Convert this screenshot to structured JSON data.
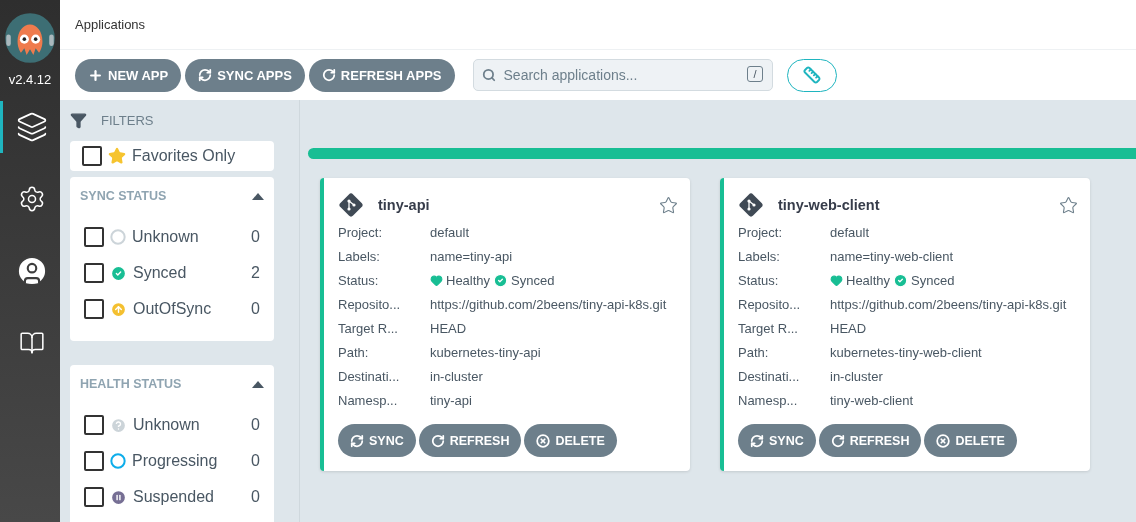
{
  "nav": {
    "version": "v2.4.12",
    "items": [
      {
        "kind": "applications",
        "selected": true
      },
      {
        "kind": "settings",
        "selected": false
      },
      {
        "kind": "user",
        "selected": false
      },
      {
        "kind": "docs",
        "selected": false
      }
    ]
  },
  "header": {
    "title": "Applications"
  },
  "toolbar": {
    "buttons": [
      {
        "kind": "plus",
        "label": "NEW APP"
      },
      {
        "kind": "sync",
        "label": "SYNC APPS"
      },
      {
        "kind": "refresh",
        "label": "REFRESH APPS"
      }
    ],
    "search": {
      "placeholder": "Search applications...",
      "shortcut": "/"
    }
  },
  "filters": {
    "title": "FILTERS",
    "favorites": {
      "label": "Favorites Only",
      "checked": false
    },
    "groups": [
      {
        "title": "SYNC STATUS",
        "expanded": true,
        "items": [
          {
            "kind": "unknown-sync",
            "label": "Unknown",
            "count": "0",
            "checked": false
          },
          {
            "kind": "synced",
            "label": "Synced",
            "count": "2",
            "checked": false
          },
          {
            "kind": "outofsync",
            "label": "OutOfSync",
            "count": "0",
            "checked": false
          }
        ]
      },
      {
        "title": "HEALTH STATUS",
        "expanded": true,
        "items": [
          {
            "kind": "unknown-health",
            "label": "Unknown",
            "count": "0",
            "checked": false
          },
          {
            "kind": "progressing",
            "label": "Progressing",
            "count": "0",
            "checked": false
          },
          {
            "kind": "suspended",
            "label": "Suspended",
            "count": "0",
            "checked": false
          }
        ]
      }
    ]
  },
  "apps": [
    {
      "name": "tiny-api",
      "favorite": false,
      "fields": [
        {
          "kind": "text",
          "label": "Project:",
          "value": "default"
        },
        {
          "kind": "text",
          "label": "Labels:",
          "value": "name=tiny-api"
        },
        {
          "kind": "status",
          "label": "Status:",
          "health": "Healthy",
          "sync": "Synced"
        },
        {
          "kind": "text",
          "label": "Reposito...",
          "value": "https://github.com/2beens/tiny-api-k8s.git"
        },
        {
          "kind": "text",
          "label": "Target R...",
          "value": "HEAD"
        },
        {
          "kind": "text",
          "label": "Path:",
          "value": "kubernetes-tiny-api"
        },
        {
          "kind": "text",
          "label": "Destinati...",
          "value": "in-cluster"
        },
        {
          "kind": "text",
          "label": "Namesp...",
          "value": "tiny-api"
        }
      ],
      "actions": [
        {
          "kind": "sync",
          "label": "SYNC"
        },
        {
          "kind": "refresh",
          "label": "REFRESH"
        },
        {
          "kind": "delete",
          "label": "DELETE"
        }
      ]
    },
    {
      "name": "tiny-web-client",
      "favorite": false,
      "fields": [
        {
          "kind": "text",
          "label": "Project:",
          "value": "default"
        },
        {
          "kind": "text",
          "label": "Labels:",
          "value": "name=tiny-web-client"
        },
        {
          "kind": "status",
          "label": "Status:",
          "health": "Healthy",
          "sync": "Synced"
        },
        {
          "kind": "text",
          "label": "Reposito...",
          "value": "https://github.com/2beens/tiny-api-k8s.git"
        },
        {
          "kind": "text",
          "label": "Target R...",
          "value": "HEAD"
        },
        {
          "kind": "text",
          "label": "Path:",
          "value": "kubernetes-tiny-web-client"
        },
        {
          "kind": "text",
          "label": "Destinati...",
          "value": "in-cluster"
        },
        {
          "kind": "text",
          "label": "Namesp...",
          "value": "tiny-web-client"
        }
      ],
      "actions": [
        {
          "kind": "sync",
          "label": "SYNC"
        },
        {
          "kind": "refresh",
          "label": "REFRESH"
        },
        {
          "kind": "delete",
          "label": "DELETE"
        }
      ]
    }
  ]
}
